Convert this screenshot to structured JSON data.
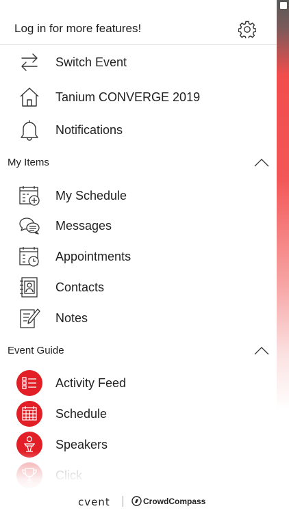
{
  "header": {
    "title": "Log in for more features!"
  },
  "top_items": [
    {
      "label": "Switch Event",
      "icon": "switch-arrows-icon"
    },
    {
      "label": "Tanium CONVERGE 2019",
      "icon": "home-icon"
    },
    {
      "label": "Notifications",
      "icon": "bell-icon"
    }
  ],
  "my_items": {
    "title": "My Items",
    "items": [
      {
        "label": "My Schedule",
        "icon": "calendar-add-icon"
      },
      {
        "label": "Messages",
        "icon": "chat-bubbles-icon"
      },
      {
        "label": "Appointments",
        "icon": "calendar-clock-icon"
      },
      {
        "label": "Contacts",
        "icon": "contact-book-icon"
      },
      {
        "label": "Notes",
        "icon": "notepad-pencil-icon"
      }
    ]
  },
  "event_guide": {
    "title": "Event Guide",
    "items": [
      {
        "label": "Activity Feed",
        "icon": "list-icon"
      },
      {
        "label": "Schedule",
        "icon": "calendar-grid-icon"
      },
      {
        "label": "Speakers",
        "icon": "speaker-podium-icon"
      },
      {
        "label": "Click",
        "icon": "trophy-icon"
      }
    ]
  },
  "footer": {
    "brand": "cvent",
    "partner": "CrowdCompass"
  },
  "colors": {
    "accent": "#e21f26"
  }
}
